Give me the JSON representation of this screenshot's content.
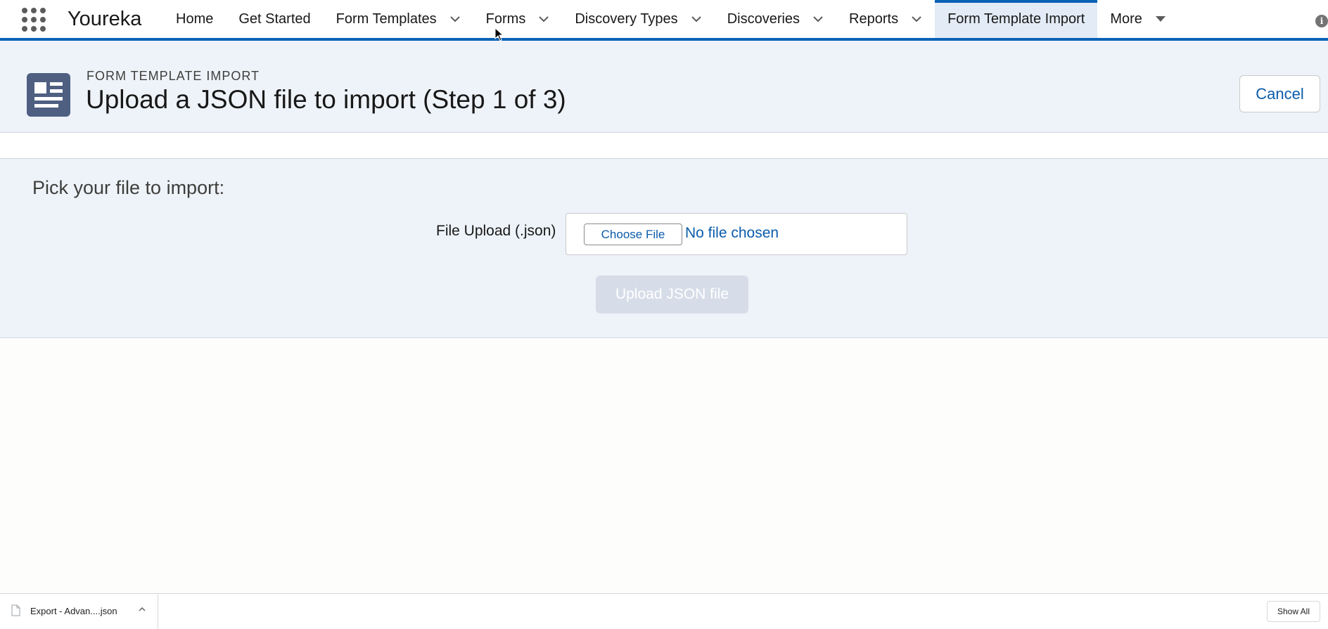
{
  "app": {
    "name": "Youreka"
  },
  "nav": {
    "items": [
      {
        "label": "Home",
        "has_menu": false
      },
      {
        "label": "Get Started",
        "has_menu": false
      },
      {
        "label": "Form Templates",
        "has_menu": true
      },
      {
        "label": "Forms",
        "has_menu": true
      },
      {
        "label": "Discovery Types",
        "has_menu": true
      },
      {
        "label": "Discoveries",
        "has_menu": true
      },
      {
        "label": "Reports",
        "has_menu": true
      },
      {
        "label": "Form Template Import",
        "has_menu": false,
        "active": true
      },
      {
        "label": "More",
        "has_menu": true
      }
    ]
  },
  "header": {
    "eyebrow": "FORM TEMPLATE IMPORT",
    "title": "Upload a JSON file to import (Step 1 of 3)",
    "cancel_label": "Cancel"
  },
  "import": {
    "heading": "Pick your file to import:",
    "field_label": "File Upload (.json)",
    "choose_label": "Choose File",
    "file_status": "No file chosen",
    "upload_label": "Upload JSON file"
  },
  "downloads": {
    "file_name": "Export - Advan....json",
    "show_all_label": "Show All"
  },
  "colors": {
    "accent": "#0b62b5",
    "header_bg": "#eef3f9",
    "icon_bg": "#4e5f82",
    "link": "#0b5cab",
    "disabled_button": "#d6dde8"
  }
}
